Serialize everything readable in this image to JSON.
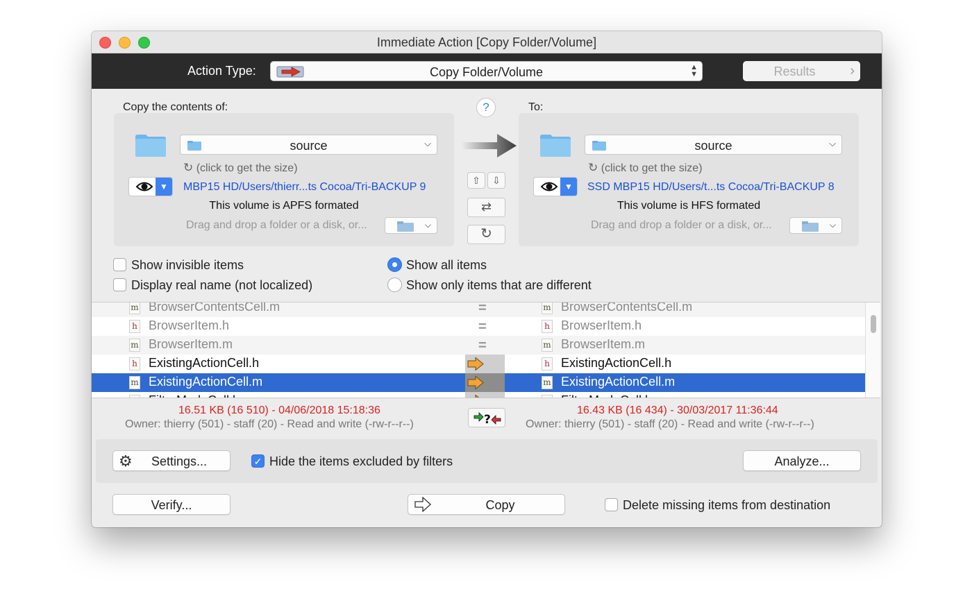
{
  "window": {
    "title": "Immediate Action [Copy Folder/Volume]"
  },
  "action_bar": {
    "label": "Action Type:",
    "selected": "Copy Folder/Volume",
    "results_label": "Results"
  },
  "source": {
    "header": "Copy the contents of:",
    "folder": "source",
    "size_hint": "(click to get the size)",
    "path": "MBP15 HD/Users/thierr...ts Cocoa/Tri-BACKUP 9",
    "format": "This volume is APFS formated",
    "drag_hint": "Drag and drop a folder or a disk, or..."
  },
  "destination": {
    "header": "To:",
    "folder": "source",
    "size_hint": "(click to get the size)",
    "path": "SSD MBP15 HD/Users/t...ts Cocoa/Tri-BACKUP 8",
    "format": "This volume is HFS formated",
    "drag_hint": "Drag and drop a folder or a disk, or..."
  },
  "help_label": "?",
  "options": {
    "show_invisible": "Show invisible items",
    "display_real_name": "Display real name (not localized)",
    "show_all": "Show all items",
    "show_different": "Show only items that are different",
    "show_all_selected": true
  },
  "file_list": {
    "rows": [
      {
        "left_type": "m",
        "left": "BrowserContentsCell.m",
        "status": "equal",
        "right_type": "m",
        "right": "BrowserContentsCell.m"
      },
      {
        "left_type": "h",
        "left": "BrowserItem.h",
        "status": "equal",
        "right_type": "h",
        "right": "BrowserItem.h"
      },
      {
        "left_type": "m",
        "left": "BrowserItem.m",
        "status": "equal",
        "right_type": "m",
        "right": "BrowserItem.m"
      },
      {
        "left_type": "h",
        "left": "ExistingActionCell.h",
        "status": "copy",
        "right_type": "h",
        "right": "ExistingActionCell.h"
      },
      {
        "left_type": "m",
        "left": "ExistingActionCell.m",
        "status": "copy",
        "right_type": "m",
        "right": "ExistingActionCell.m",
        "selected": true
      },
      {
        "left_type": "h",
        "left": "FilterModeCell.h",
        "status": "copy",
        "right_type": "h",
        "right": "FilterModeCell.h"
      }
    ]
  },
  "selected_info": {
    "left_size_date": "16.51 KB (16 510) - 04/06/2018 15:18:36",
    "left_owner": "Owner: thierry (501) - staff (20) - Read and write (-rw-r--r--)",
    "right_size_date": "16.43 KB (16 434) - 30/03/2017 11:36:44",
    "right_owner": "Owner: thierry (501) - staff (20) - Read and write (-rw-r--r--)"
  },
  "bottom": {
    "settings_label": "Settings...",
    "hide_excluded_label": "Hide the items excluded by filters",
    "hide_excluded_checked": true,
    "analyze_label": "Analyze...",
    "verify_label": "Verify...",
    "copy_label": "Copy",
    "delete_missing_label": "Delete missing items from destination"
  },
  "icons": {
    "folder": "folder-icon",
    "eye": "eye-icon",
    "refresh": "refresh-icon",
    "gear": "gear-icon",
    "arrow": "arrow-right-icon",
    "compare": "compare-icon"
  },
  "colors": {
    "accent": "#3d82f0",
    "selection": "#2f6ad0",
    "path_link": "#1a4fd6",
    "info_red": "#dd2222",
    "copy_arrow": "#f2a33a"
  }
}
